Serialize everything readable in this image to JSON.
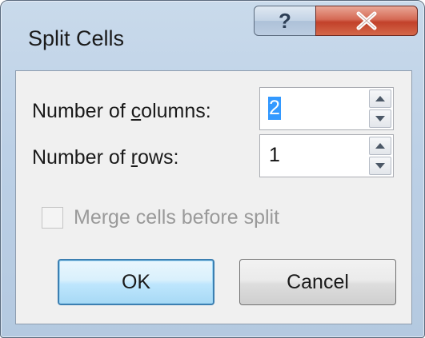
{
  "dialog": {
    "title": "Split Cells",
    "help_glyph": "?",
    "close_glyph": "X"
  },
  "fields": {
    "columns": {
      "label_pre": "Number of ",
      "label_key": "c",
      "label_post": "olumns:",
      "value": "2"
    },
    "rows": {
      "label_pre": "Number of ",
      "label_key": "r",
      "label_post": "ows:",
      "value": "1"
    }
  },
  "merge": {
    "label": "Merge cells before split",
    "checked": false,
    "enabled": false
  },
  "buttons": {
    "ok": "OK",
    "cancel": "Cancel"
  },
  "colors": {
    "accent": "#3399ff",
    "close": "#c2412a",
    "frame": "#bcd0e6"
  }
}
